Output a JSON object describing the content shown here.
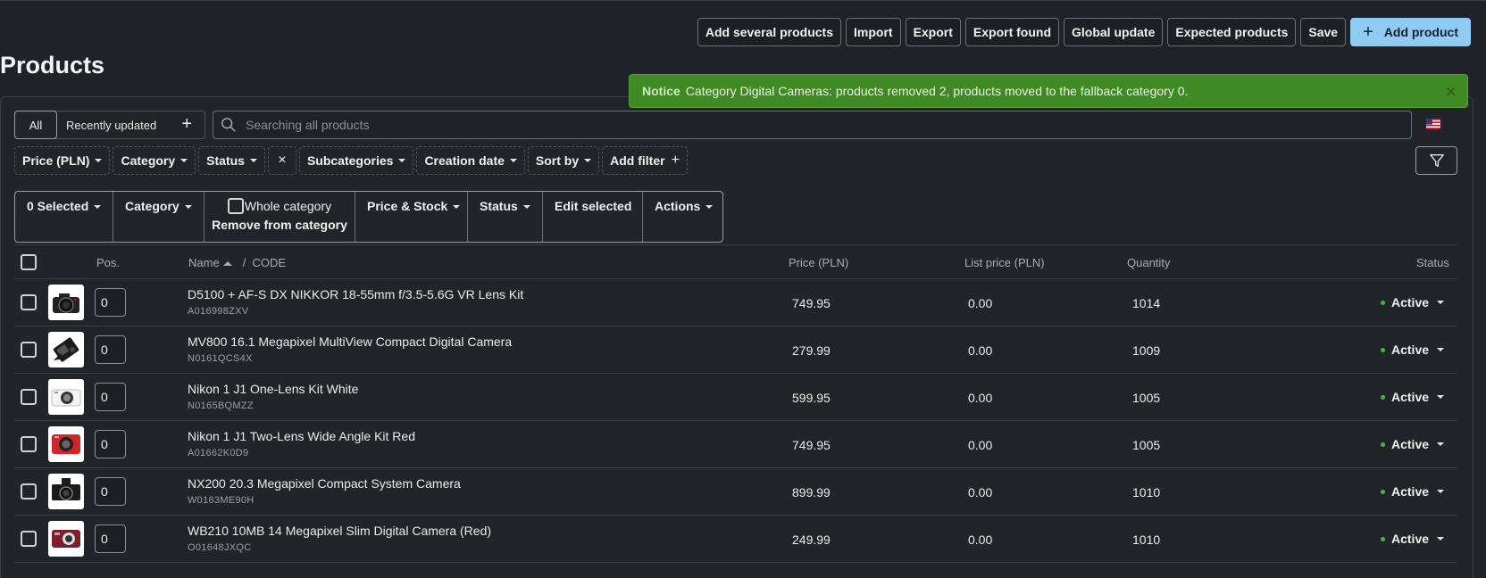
{
  "toolbar": {
    "add_several": "Add several products",
    "import": "Import",
    "export": "Export",
    "export_found": "Export found",
    "global_update": "Global update",
    "expected_products": "Expected products",
    "save": "Save",
    "add_product": "Add product"
  },
  "page_title": "Products",
  "notice": {
    "title": "Notice",
    "message": "Category Digital Cameras: products removed 2, products moved to the fallback category 0.",
    "close": "×"
  },
  "views": {
    "all": "All",
    "recent": "Recently updated",
    "add": "+"
  },
  "search": {
    "placeholder": "Searching all products"
  },
  "filters": {
    "price": "Price (PLN)",
    "category": "Category",
    "status": "Status",
    "clear": "×",
    "subcategories": "Subcategories",
    "creation_date": "Creation date",
    "sort_by": "Sort by",
    "add_filter": "Add filter",
    "add_filter_plus": "+"
  },
  "bulk": {
    "selected": "0 Selected",
    "category": "Category",
    "whole_category": "Whole category",
    "remove_from_category": "Remove from category",
    "price_stock": "Price & Stock",
    "status": "Status",
    "edit_selected": "Edit selected",
    "actions": "Actions"
  },
  "table": {
    "headers": {
      "pos": "Pos.",
      "name": "Name",
      "code_sep": "/",
      "code": "CODE",
      "price": "Price (PLN)",
      "list_price": "List price (PLN)",
      "quantity": "Quantity",
      "status": "Status"
    },
    "rows": [
      {
        "pos": "0",
        "name": "D5100 + AF-S DX NIKKOR 18-55mm f/3.5-5.6G VR Lens Kit",
        "code": "A016998ZXV",
        "price": "749.95",
        "list_price": "0.00",
        "quantity": "1014",
        "status": "Active",
        "thumb": "dslr-camera-black"
      },
      {
        "pos": "0",
        "name": "MV800 16.1 Megapixel MultiView Compact Digital Camera",
        "code": "N0161QCS4X",
        "price": "279.99",
        "list_price": "0.00",
        "quantity": "1009",
        "status": "Active",
        "thumb": "compact-camera-black-angled"
      },
      {
        "pos": "0",
        "name": "Nikon 1 J1 One-Lens Kit White",
        "code": "N0165BQMZZ",
        "price": "599.95",
        "list_price": "0.00",
        "quantity": "1005",
        "status": "Active",
        "thumb": "mirrorless-camera-white"
      },
      {
        "pos": "0",
        "name": "Nikon 1 J1 Two-Lens Wide Angle Kit Red",
        "code": "A01662K0D9",
        "price": "749.95",
        "list_price": "0.00",
        "quantity": "1005",
        "status": "Active",
        "thumb": "mirrorless-camera-red"
      },
      {
        "pos": "0",
        "name": "NX200 20.3 Megapixel Compact System Camera",
        "code": "W0163ME90H",
        "price": "899.99",
        "list_price": "0.00",
        "quantity": "1010",
        "status": "Active",
        "thumb": "system-camera-black-flash"
      },
      {
        "pos": "0",
        "name": "WB210 10MB 14 Megapixel Slim Digital Camera (Red)",
        "code": "O01648JXQC",
        "price": "249.99",
        "list_price": "0.00",
        "quantity": "1010",
        "status": "Active",
        "thumb": "slim-camera-red"
      }
    ]
  },
  "colors": {
    "background": "#1f2226",
    "primary_button": "#8fcbf3",
    "notice_bg": "#3f8a25",
    "status_dot": "#4caf50"
  }
}
